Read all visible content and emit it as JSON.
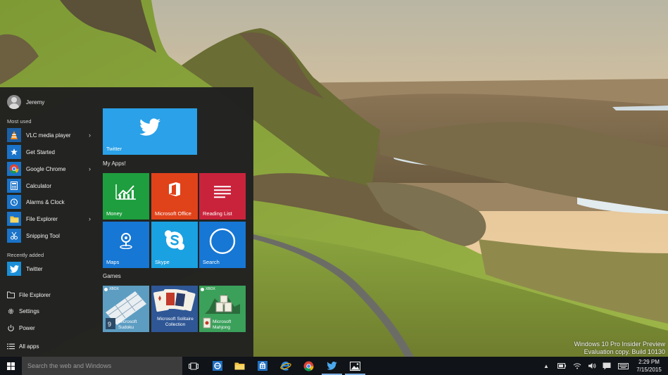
{
  "desktop": {
    "watermark_line1": "Windows 10 Pro Insider Preview",
    "watermark_line2": "Evaluation copy. Build 10130"
  },
  "start_menu": {
    "user_name": "Jeremy",
    "most_used_label": "Most used",
    "most_used": [
      {
        "label": "VLC media player",
        "icon": "vlc-icon",
        "has_submenu": true
      },
      {
        "label": "Get Started",
        "icon": "get-started-icon",
        "has_submenu": false
      },
      {
        "label": "Google Chrome",
        "icon": "chrome-icon",
        "has_submenu": true
      },
      {
        "label": "Calculator",
        "icon": "calculator-icon",
        "has_submenu": false
      },
      {
        "label": "Alarms & Clock",
        "icon": "alarm-icon",
        "has_submenu": false
      },
      {
        "label": "File Explorer",
        "icon": "folder-icon",
        "has_submenu": true
      },
      {
        "label": "Snipping Tool",
        "icon": "scissors-icon",
        "has_submenu": false
      }
    ],
    "recently_added_label": "Recently added",
    "recently_added": [
      {
        "label": "Twitter",
        "icon": "twitter-icon"
      }
    ],
    "system": [
      {
        "label": "File Explorer",
        "icon": "folder-outline-icon"
      },
      {
        "label": "Settings",
        "icon": "gear-icon"
      },
      {
        "label": "Power",
        "icon": "power-icon"
      },
      {
        "label": "All apps",
        "icon": "all-apps-icon"
      }
    ],
    "tiles": {
      "twitter": {
        "label": "Twitter",
        "color": "#2aa1e8"
      },
      "my_apps_label": "My Apps!",
      "my_apps": [
        {
          "label": "Money",
          "color": "#1e9e3e",
          "icon": "money-chart-icon"
        },
        {
          "label": "Microsoft Office",
          "color": "#e0421a",
          "icon": "office-icon"
        },
        {
          "label": "Reading List",
          "color": "#c9233b",
          "icon": "reading-list-icon"
        },
        {
          "label": "Maps",
          "color": "#1677d4",
          "icon": "maps-icon"
        },
        {
          "label": "Skype",
          "color": "#1aa1e2",
          "icon": "skype-icon"
        },
        {
          "label": "Search",
          "color": "#1677d4",
          "icon": "search-ring-icon"
        }
      ],
      "games_label": "Games",
      "games": [
        {
          "label": "Microsoft Sudoku",
          "badge": "XBOX",
          "color": "#4f8fb5"
        },
        {
          "label": "Microsoft Solitaire Collection",
          "badge": "",
          "color": "#3b66a8"
        },
        {
          "label": "Microsoft Mahjong",
          "badge": "XBOX",
          "color": "#2f8a4a"
        }
      ]
    }
  },
  "taskbar": {
    "search_placeholder": "Search the web and Windows",
    "apps": [
      "task-view-icon",
      "ie-blue-icon",
      "file-explorer-icon",
      "store-icon",
      "edge-icon",
      "chrome-icon",
      "twitter-icon",
      "photos-icon"
    ],
    "time": "2:29 PM",
    "date": "7/15/2015"
  }
}
